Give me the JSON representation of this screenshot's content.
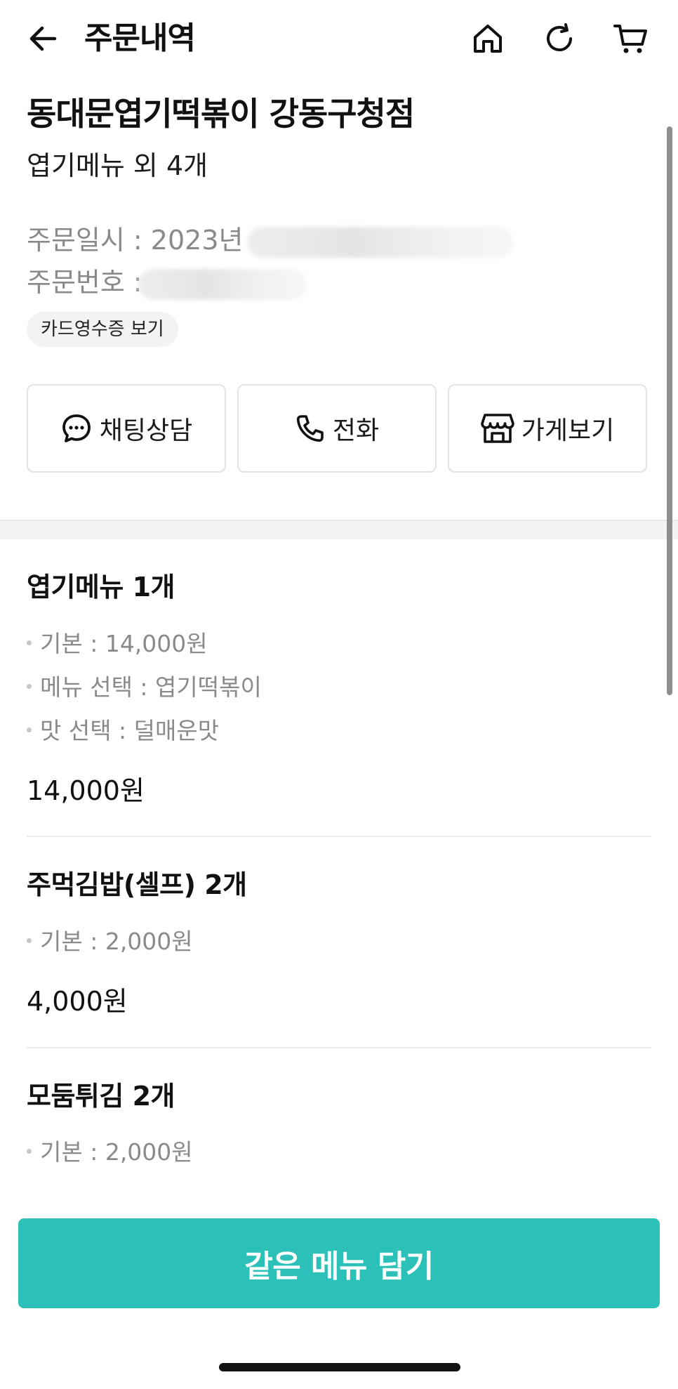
{
  "header": {
    "title": "주문내역",
    "icons": [
      "back-arrow-icon",
      "home-icon",
      "refresh-icon",
      "cart-icon"
    ]
  },
  "store": {
    "name": "동대문엽기떡볶이 강동구청점",
    "summary": "엽기메뉴 외 4개",
    "order_date_label": "주문일시 : 2023년",
    "order_number_label": "주문번호 :",
    "receipt_chip": "카드영수증 보기"
  },
  "actions": {
    "chat": "채팅상담",
    "call": "전화",
    "store": "가게보기"
  },
  "items": [
    {
      "name": "엽기메뉴 1개",
      "options": [
        "기본 : 14,000원",
        "메뉴 선택 : 엽기떡볶이",
        "맛 선택 : 덜매운맛"
      ],
      "price": "14,000원"
    },
    {
      "name": "주먹김밥(셀프) 2개",
      "options": [
        "기본 : 2,000원"
      ],
      "price": "4,000원"
    },
    {
      "name": "모둠튀김 2개",
      "options": [
        "기본 : 2,000원"
      ]
    }
  ],
  "cta": {
    "label": "같은 메뉴 담기"
  },
  "colors": {
    "accent": "#2bc1b9",
    "text": "#111111",
    "muted": "#8a8a8a",
    "chip_bg": "#f2f3f5",
    "border": "#e3e3e3"
  }
}
